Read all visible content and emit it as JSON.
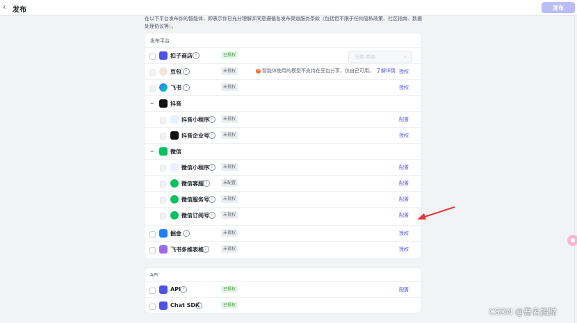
{
  "header": {
    "back_icon": "chevron-left-icon",
    "title": "发布",
    "publish_label": "发布"
  },
  "intro": {
    "text_before": "在以下平台发布你的智能体，即表示你已充分理解并同意遵循各发布渠道服务条款",
    "link": "",
    "text_after": "（包括但不限于任何隐私政策、社区指南、数据处理协议等）。"
  },
  "section_platforms": {
    "title": "发布平台",
    "rows": [
      {
        "name": "扣子商店",
        "badge": "已授权",
        "status": "ok",
        "select_placeholder": "分类  商务"
      },
      {
        "name": "豆包",
        "badge": "未授权",
        "status": "no",
        "warning": "智能体使用的模型不支持在豆包分享，仅自己可用。",
        "warning_link": "了解详情",
        "action": "授权"
      },
      {
        "name": "飞书",
        "badge": "未授权",
        "status": "no",
        "action": "授权"
      },
      {
        "name": "抖音",
        "group": true
      },
      {
        "name": "抖音小程序",
        "badge": "未授权",
        "status": "no",
        "action": "配置"
      },
      {
        "name": "抖音企业号",
        "badge": "未授权",
        "status": "no",
        "action": "授权"
      },
      {
        "name": "微信",
        "group": true
      },
      {
        "name": "微信小程序",
        "badge": "未授权",
        "status": "no",
        "action": "配置"
      },
      {
        "name": "微信客服",
        "badge": "未配置",
        "status": "no",
        "action": "配置"
      },
      {
        "name": "微信服务号",
        "badge": "未授权",
        "status": "no",
        "action": "配置"
      },
      {
        "name": "微信订阅号",
        "badge": "未授权",
        "status": "no",
        "action": "配置"
      },
      {
        "name": "掘金",
        "badge": "未授权",
        "status": "no",
        "action": "授权"
      },
      {
        "name": "飞书多维表格",
        "badge": "未授权",
        "status": "no",
        "action": "授权"
      }
    ]
  },
  "section_api": {
    "title": "API",
    "rows": [
      {
        "name": "API",
        "badge": "已授权",
        "status": "ok",
        "action": "配置"
      },
      {
        "name": "Chat SDK",
        "badge": "已授权",
        "status": "ok"
      }
    ]
  },
  "colors": {
    "accent": "#4d53e8",
    "ok_text": "#2ea121",
    "arrow": "#e8333a"
  },
  "watermark": "CSDN @吾名招财"
}
